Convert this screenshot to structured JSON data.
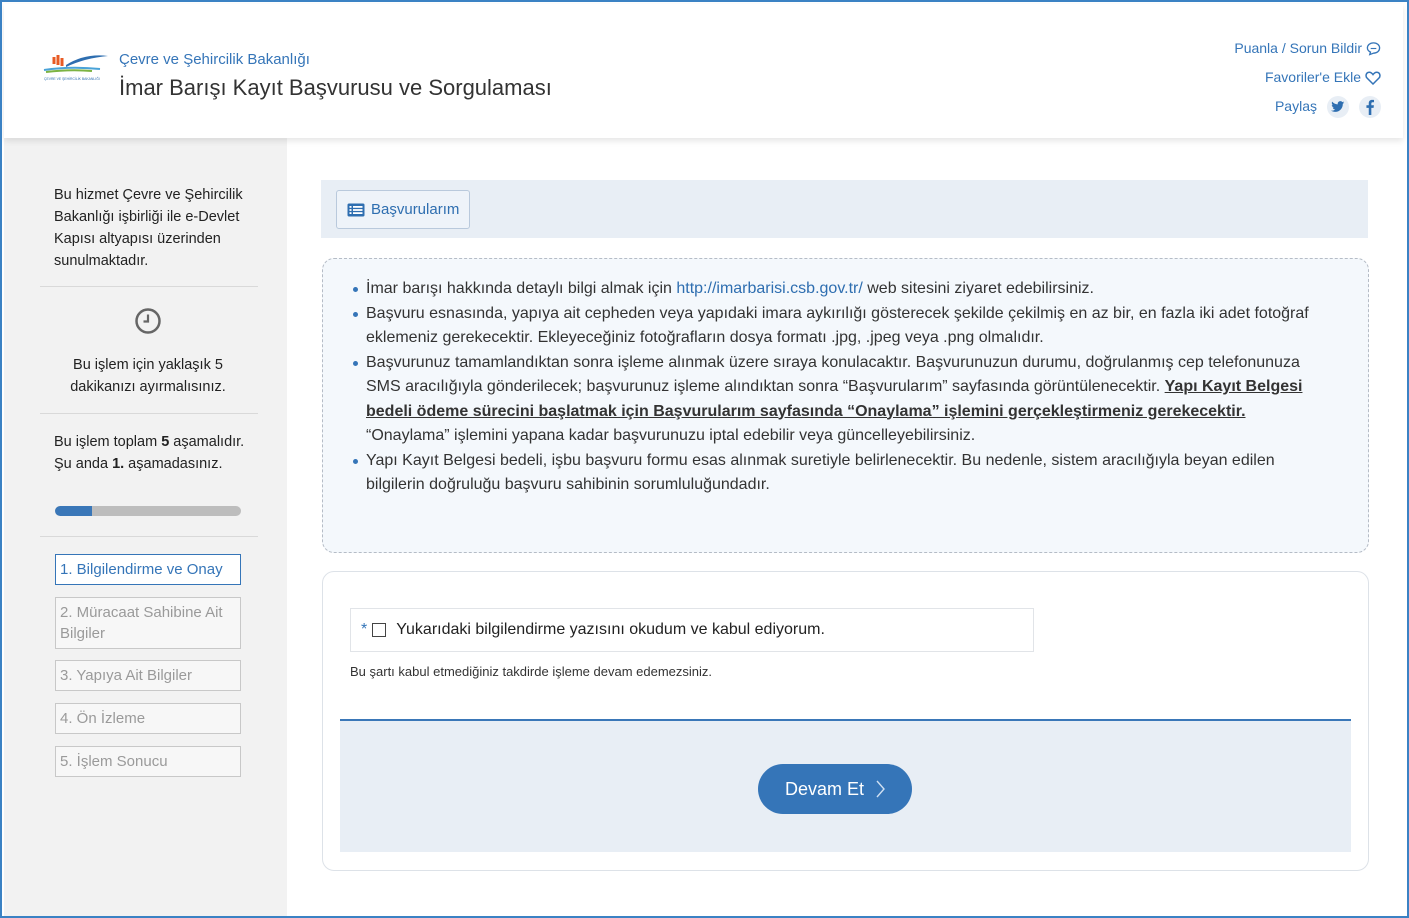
{
  "header": {
    "ministry": "Çevre ve Şehircilik Bakanlığı",
    "service_title": "İmar Barışı Kayıt Başvurusu ve Sorgulaması",
    "logo_text": "ÇEVRE VE ŞEHİRCİLİK BAKANLIĞI",
    "links": {
      "rate": "Puanla / Sorun Bildir",
      "favorites": "Favoriler'e Ekle",
      "share": "Paylaş"
    }
  },
  "sidebar": {
    "intro": "Bu hizmet Çevre ve Şehircilik Bakanlığı işbirliği ile e-Devlet Kapısı altyapısı üzerinden sunulmaktadır.",
    "time_note": "Bu işlem için yaklaşık 5 dakikanızı ayırmalısınız.",
    "stage_prefix": "Bu işlem toplam ",
    "stage_total": "5",
    "stage_suffix": " aşamalıdır.",
    "current_prefix": "Şu anda ",
    "current_step": "1.",
    "current_suffix": " aşamadasınız.",
    "progress_fraction": 0.2,
    "steps": [
      {
        "label": "1. Bilgilendirme ve Onay"
      },
      {
        "label": "2. Müracaat Sahibine Ait Bilgiler"
      },
      {
        "label": "3. Yapıya Ait Bilgiler"
      },
      {
        "label": "4. Ön İzleme"
      },
      {
        "label": "5. İşlem Sonucu"
      }
    ]
  },
  "toolbar": {
    "basvurularim_label": "Başvurularım"
  },
  "info": {
    "item1_pre": "İmar barışı hakkında detaylı bilgi almak için ",
    "item1_link": "http://imarbarisi.csb.gov.tr/",
    "item1_post": " web sitesini ziyaret edebilirsiniz.",
    "item2": "Başvuru esnasında, yapıya ait cepheden veya yapıdaki imara aykırılığı gösterecek şekilde çekilmiş en az bir, en fazla iki adet fotoğraf eklemeniz gerekecektir. Ekleyeceğiniz fotoğrafların dosya formatı .jpg, .jpeg veya .png olmalıdır.",
    "item3_pre": "Başvurunuz tamamlandıktan sonra işleme alınmak üzere sıraya konulacaktır. Başvurunuzun durumu, doğrulanmış cep telefonunuza SMS aracılığıyla gönderilecek; başvurunuz işleme alındıktan sonra “Başvurularım” sayfasında görüntülenecektir. ",
    "item3_bold": "Yapı Kayıt Belgesi bedeli ödeme sürecini başlatmak için Başvurularım sayfasında “Onaylama” işlemini gerçekleştirmeniz gerekecektir.",
    "item3_post": " “Onaylama” işlemini yapana kadar başvurunuzu iptal edebilir veya güncelleyebilirsiniz.",
    "item4": "Yapı Kayıt Belgesi bedeli, işbu başvuru formu esas alınmak suretiyle belirlenecektir. Bu nedenle, sistem aracılığıyla beyan edilen bilgilerin doğruluğu başvuru sahibinin sorumluluğundadır."
  },
  "form": {
    "required_mark": "*",
    "accept_label": "Yukarıdaki bilgilendirme yazısını okudum ve kabul ediyorum.",
    "accept_checked": false,
    "warning": "Bu şartı kabul etmediğiniz takdirde işleme devam edemezsiniz.",
    "continue_label": "Devam Et"
  },
  "colors": {
    "brand": "#3575b8",
    "frame": "#3b82c4",
    "panel": "#e8eef5"
  }
}
